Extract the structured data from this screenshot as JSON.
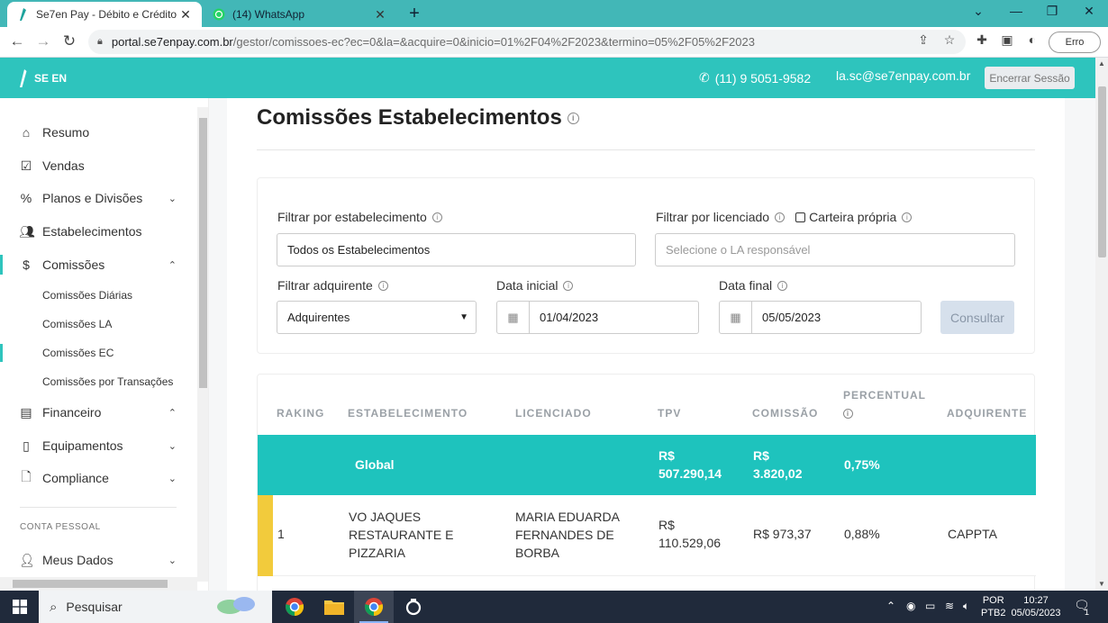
{
  "browser": {
    "tabs": [
      {
        "title": "Se7en Pay - Débito e Crédito",
        "active": true
      },
      {
        "title": "(14) WhatsApp",
        "active": false
      }
    ],
    "url_host": "portal.se7enpay.com.br",
    "url_rest": "/gestor/comissoes-ec?ec=0&la=&acquire=0&inicio=01%2F04%2F2023&termino=05%2F05%2F2023",
    "profile_status": "Erro"
  },
  "header": {
    "logo_text": "SE EN",
    "phone": "(11) 9 5051-9582",
    "email": "la.sc@se7enpay.com.br",
    "logout_label": "Encerrar Sessão"
  },
  "sidebar": {
    "items": [
      {
        "label": "Resumo",
        "icon": "home-icon"
      },
      {
        "label": "Vendas",
        "icon": "calendar-check-icon"
      },
      {
        "label": "Planos e Divisões",
        "icon": "percent-icon"
      },
      {
        "label": "Estabelecimentos",
        "icon": "users-icon"
      },
      {
        "label": "Comissões",
        "icon": "dollar-icon"
      },
      {
        "label": "Financeiro",
        "icon": "document-icon"
      },
      {
        "label": "Equipamentos",
        "icon": "device-icon"
      },
      {
        "label": "Compliance",
        "icon": "file-icon"
      },
      {
        "label": "Meus Dados",
        "icon": "user-icon"
      }
    ],
    "sub_items": [
      "Comissões Diárias",
      "Comissões LA",
      "Comissões EC",
      "Comissões por Transações"
    ],
    "section_label": "CONTA PESSOAL"
  },
  "page": {
    "title": "Comissões Estabelecimentos"
  },
  "filters": {
    "establishment_label": "Filtrar por estabelecimento",
    "establishment_value": "Todos os Estabelecimentos",
    "licensee_label": "Filtrar por licenciado",
    "own_portfolio_label": "Carteira própria",
    "licensee_placeholder": "Selecione o LA responsável",
    "acquirer_label": "Filtrar adquirente",
    "acquirer_value": "Adquirentes",
    "start_label": "Data inicial",
    "start_value": "01/04/2023",
    "end_label": "Data final",
    "end_value": "05/05/2023",
    "submit_label": "Consultar"
  },
  "table": {
    "headers": {
      "rank": "RAKING",
      "establishment": "ESTABELECIMENTO",
      "licensee": "LICENCIADO",
      "tpv": "TPV",
      "commission": "COMISSÃO",
      "percent": "PERCENTUAL",
      "acquirer": "ADQUIRENTE"
    },
    "global": {
      "label": "Global",
      "tpv_currency": "R$",
      "tpv": "507.290,14",
      "commission_currency": "R$",
      "commission": "3.820,02",
      "percent": "0,75%"
    },
    "rows": [
      {
        "rank": "1",
        "establishment": "VO JAQUES RESTAURANTE E PIZZARIA",
        "licensee": "MARIA EDUARDA FERNANDES DE BORBA",
        "tpv_currency": "R$",
        "tpv": "110.529,06",
        "commission": "R$ 973,37",
        "percent": "0,88%",
        "acquirer": "CAPPTA"
      }
    ]
  },
  "taskbar": {
    "search_placeholder": "Pesquisar",
    "lang_top": "POR",
    "lang_bottom": "PTB2",
    "time": "10:27",
    "date": "05/05/2023",
    "notifications": "1"
  },
  "colors": {
    "brand": "#2ec4bd",
    "global_row": "#1ec3bd",
    "rank_gold": "#f2cb3c"
  }
}
